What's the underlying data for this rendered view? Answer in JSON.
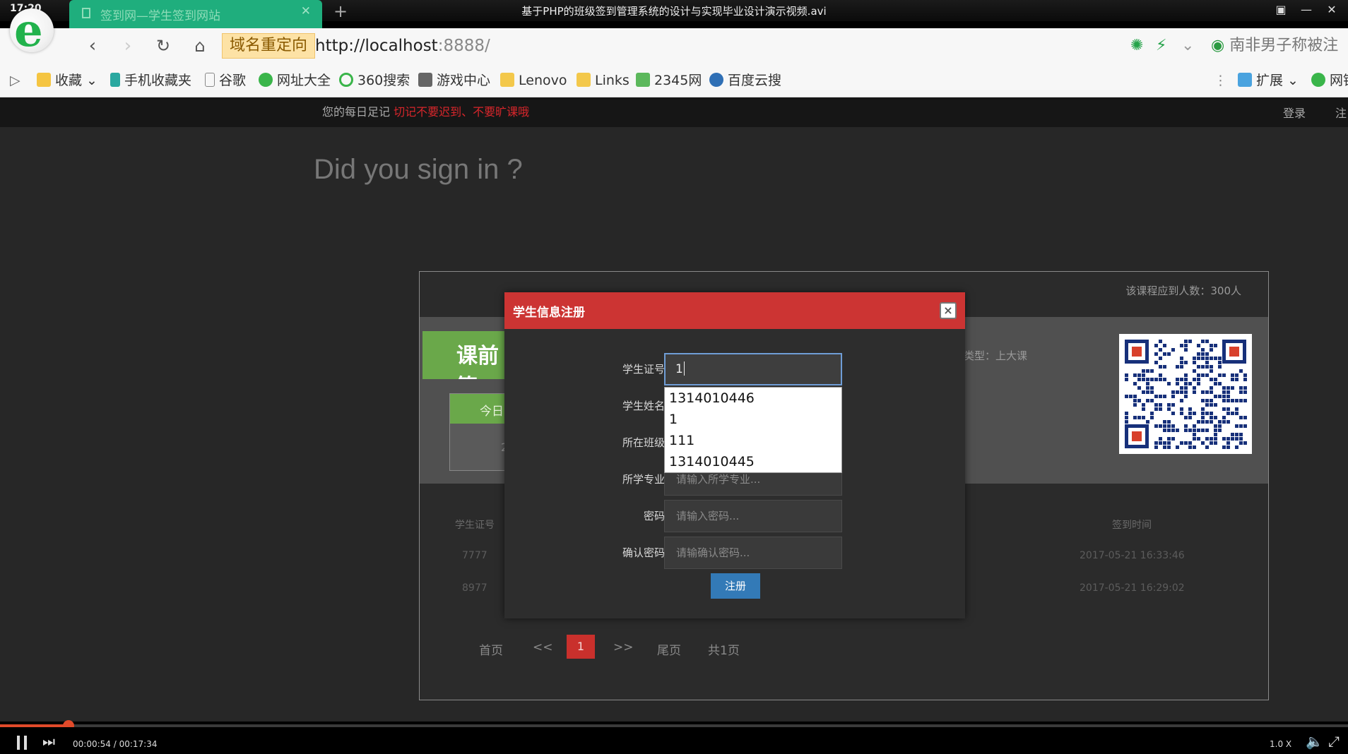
{
  "player": {
    "clock": "17:20",
    "title": "基于PHP的班级签到管理系统的设计与实现毕业设计演示视频.avi",
    "time": "00:00:54 / 00:17:34",
    "speed": "1.0 X",
    "progress_fraction": 0.051
  },
  "browser": {
    "tab_title": "签到网—学生签到网站",
    "redirect_label": "域名重定向",
    "url_host": "http://localhost",
    "url_rest": ":8888/",
    "news": "南非男子称被注",
    "bookmarks": [
      "收藏",
      "手机收藏夹",
      "谷歌",
      "网址大全",
      "360搜索",
      "游戏中心",
      "Lenovo",
      "Links",
      "2345网",
      "百度云搜"
    ],
    "extensions": "扩展",
    "net": "网银"
  },
  "site": {
    "daily_note": "您的每日足记",
    "daily_warning": "切记不要迟到、不要旷课哦",
    "login": "登录",
    "register": "注",
    "headline": "Did you sign in ?",
    "count_label": "该课程应到人数：300人",
    "green_title": "课前签",
    "today": "今日",
    "today_value": "2",
    "type_label": "类型：上大课",
    "col_id": "学生证号",
    "col_time": "签到时间",
    "rows": [
      {
        "id": "7777",
        "time": "2017-05-21 16:33:46"
      },
      {
        "id": "8977",
        "time": "2017-05-21 16:29:02"
      }
    ],
    "pager": {
      "first": "首页",
      "prev": "<<",
      "current": "1",
      "next": ">>",
      "last": "尾页",
      "total": "共1页"
    }
  },
  "modal": {
    "title": "学生信息注册",
    "close": "×",
    "fields": [
      {
        "label": "学生证号：",
        "value": "1",
        "placeholder": ""
      },
      {
        "label": "学生姓名：",
        "value": "",
        "placeholder": ""
      },
      {
        "label": "所在班级：",
        "value": "",
        "placeholder": ""
      },
      {
        "label": "所学专业：",
        "value": "",
        "placeholder": "请输入所学专业..."
      },
      {
        "label": "密码：",
        "value": "",
        "placeholder": "请输入密码..."
      },
      {
        "label": "确认密码：",
        "value": "",
        "placeholder": "请输确认密码..."
      }
    ],
    "autocomplete": [
      "1314010446",
      "1",
      "111",
      "1314010445"
    ],
    "submit": "注册"
  },
  "colors": {
    "modal_header": "#cc3433",
    "submit": "#337ab7",
    "tab": "#1fae7d",
    "progress": "#e14a2a"
  }
}
